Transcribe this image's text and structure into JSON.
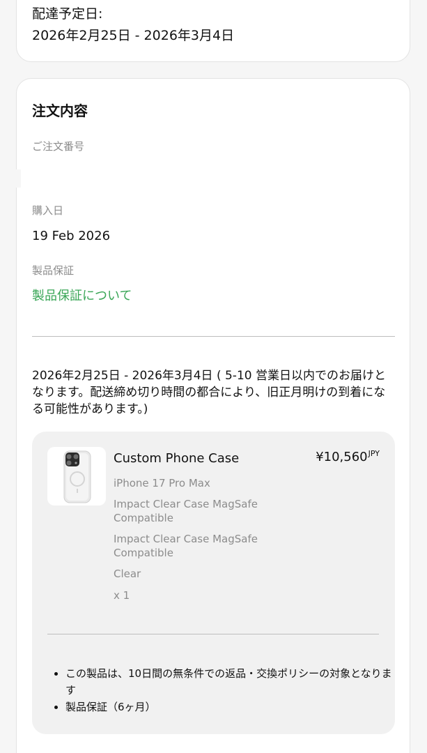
{
  "delivery": {
    "label": "配達予定日:",
    "range": "2026年2月25日 - 2026年3月4日"
  },
  "order": {
    "title": "注文内容",
    "order_number_label": "ご注文番号",
    "purchase_date_label": "購入日",
    "purchase_date": "19 Feb 2026",
    "warranty_label": "製品保証",
    "warranty_link": "製品保証について",
    "shipping_notice": "2026年2月25日 - 2026年3月4日 ( 5-10 営業日以内でのお届けとなります。配送締め切り時間の都合により、旧正月明けの到着になる可能性があります。)"
  },
  "product": {
    "name": "Custom Phone Case",
    "price": "¥10,560",
    "currency": "JPY",
    "model": "iPhone 17 Pro Max",
    "type_1": "Impact Clear Case MagSafe Compatible",
    "type_2": "Impact Clear Case MagSafe Compatible",
    "color": "Clear",
    "quantity": "x 1",
    "notes": [
      "この製品は、10日間の無条件での返品・交換ポリシーの対象となります",
      "製品保証（6ヶ月）"
    ]
  },
  "colors": {
    "link_green": "#3aa657",
    "card_bg": "#ffffff",
    "page_bg": "#f6f6f6",
    "product_box_bg": "#f1f1f1"
  }
}
